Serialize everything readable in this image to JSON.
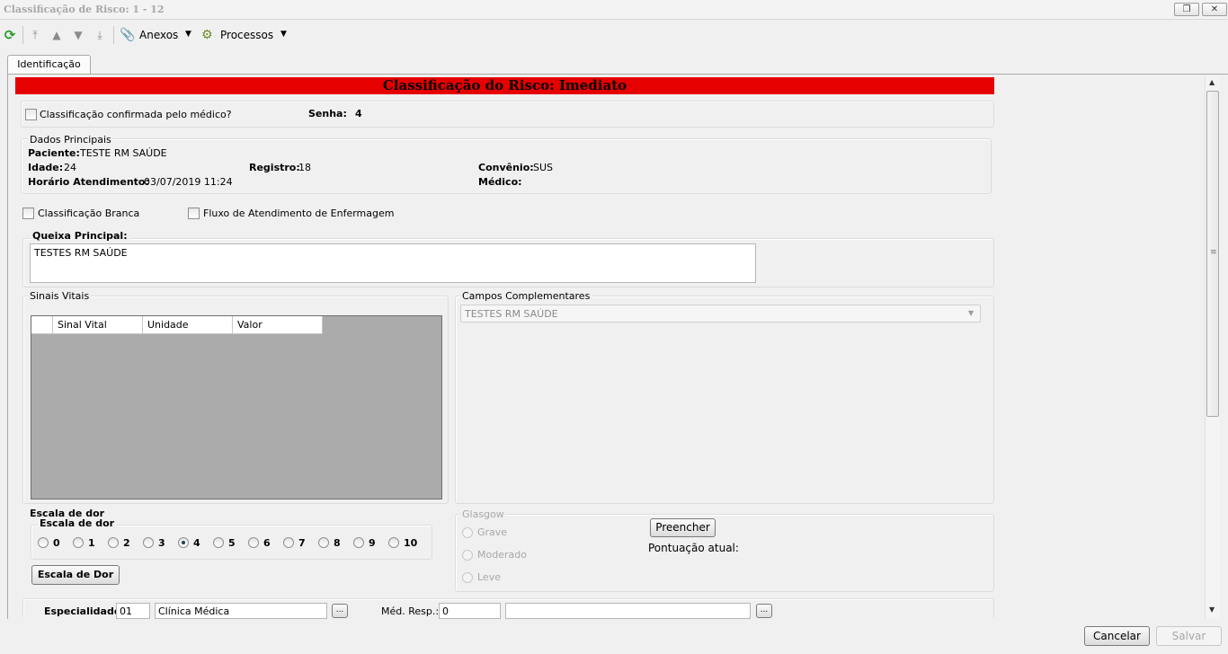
{
  "window": {
    "title": "Classificação de Risco: 1 - 12",
    "restore_label": "❐",
    "close_label": "✕"
  },
  "toolbar": {
    "anexos_label": "Anexos",
    "processos_label": "Processos"
  },
  "tabs": [
    {
      "label": "Identificação"
    }
  ],
  "risk_banner": {
    "text": "Classificação do Risco: Imediato",
    "color": "#e60000"
  },
  "confirm": {
    "label": "Classificação confirmada pelo médico?",
    "senha_label": "Senha:",
    "senha_value": "4"
  },
  "dados": {
    "title": "Dados Principais",
    "paciente_label": "Paciente:",
    "paciente_value": "TESTE RM SAÚDE",
    "idade_label": "Idade:",
    "idade_value": "24",
    "registro_label": "Registro:",
    "registro_value": "18",
    "convenio_label": "Convênio:",
    "convenio_value": "SUS",
    "horario_label": "Horário Atendimento:",
    "horario_value": "03/07/2019 11:24",
    "medico_label": "Médico:",
    "medico_value": ""
  },
  "checks": {
    "branca_label": "Classificação Branca",
    "fluxo_label": "Fluxo de Atendimento de Enfermagem"
  },
  "queixa": {
    "title": "Queixa Principal:",
    "value": "TESTES RM SAÚDE"
  },
  "sinais": {
    "title": "Sinais Vitais",
    "columns": [
      "Sinal Vital",
      "Unidade",
      "Valor"
    ]
  },
  "campos": {
    "title": "Campos Complementares",
    "selected": "TESTES RM SAÚDE"
  },
  "escala": {
    "outer_title": "Escala de dor",
    "inner_title": "Escala de dor",
    "options": [
      "0",
      "1",
      "2",
      "3",
      "4",
      "5",
      "6",
      "7",
      "8",
      "9",
      "10"
    ],
    "selected": "4",
    "button_label": "Escala de Dor"
  },
  "glasgow": {
    "title": "Glasgow",
    "options": [
      "Grave",
      "Moderado",
      "Leve"
    ],
    "preencher_label": "Preencher",
    "pontuacao_label": "Pontuação atual:"
  },
  "especialidade": {
    "label": "Especialidade:",
    "code": "01",
    "name": "Clínica Médica",
    "medresp_label": "Méd. Resp.:",
    "medresp_code": "0",
    "medresp_name": "",
    "lookup_label": "..."
  },
  "footer": {
    "cancel_label": "Cancelar",
    "save_label": "Salvar"
  }
}
